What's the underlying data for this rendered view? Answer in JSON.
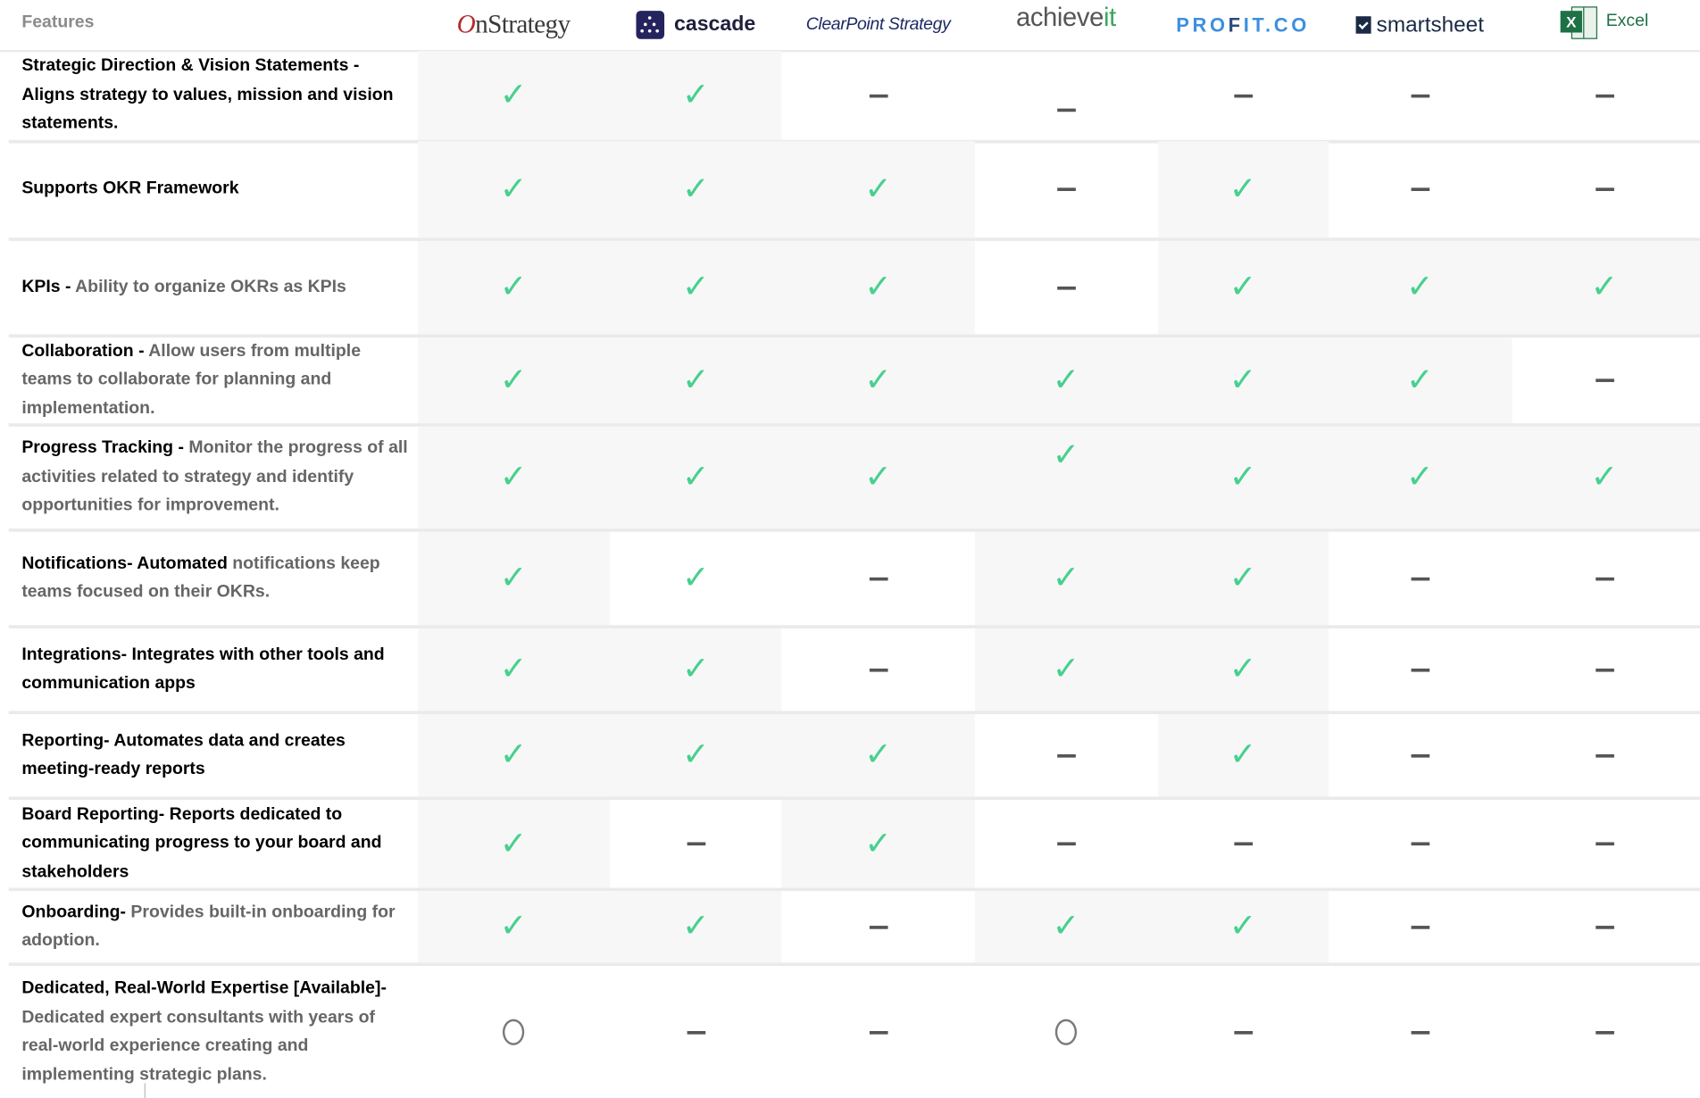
{
  "header": {
    "features_label": "Features",
    "vendors": [
      {
        "id": "onstrategy",
        "name": "OnStrategy",
        "logo_first": "O",
        "logo_rest": "nStrategy"
      },
      {
        "id": "cascade",
        "name": "cascade"
      },
      {
        "id": "clearpoint",
        "name": "ClearPoint Strategy"
      },
      {
        "id": "achieveit",
        "name": "achieveit",
        "logo_main": "achieve",
        "logo_accent": "it"
      },
      {
        "id": "profit",
        "name": "PROFIT.CO",
        "logo_main": "PRO",
        "logo_mid": "F",
        "logo_rest": "IT.CO"
      },
      {
        "id": "smartsheet",
        "name": "smartsheet"
      },
      {
        "id": "excel",
        "name": "Excel",
        "icon_letter": "X"
      }
    ]
  },
  "rows": [
    {
      "title": "Strategic Direction & Vision Statements - Aligns strategy to values, mission and vision statements.",
      "desc": "",
      "cells": [
        "check",
        "check",
        "dash",
        "dash",
        "dash",
        "dash",
        "dash"
      ]
    },
    {
      "title": "Supports OKR Framework",
      "desc": "",
      "cells": [
        "check",
        "check",
        "check",
        "dash",
        "check",
        "dash",
        "dash"
      ]
    },
    {
      "title": "KPIs - ",
      "desc": "Ability to organize OKRs as KPIs",
      "cells": [
        "check",
        "check",
        "check",
        "dash",
        "check",
        "check",
        "check"
      ]
    },
    {
      "title": "Collaboration - ",
      "desc": "Allow users from multiple teams to collaborate for planning and implementation.",
      "cells": [
        "check",
        "check",
        "check",
        "check",
        "check",
        "check",
        "dash"
      ]
    },
    {
      "title": "Progress Tracking - ",
      "desc": "Monitor the progress of all activities related to strategy and identify opportunities for improvement.",
      "cells": [
        "check",
        "check",
        "check",
        "check",
        "check",
        "check",
        "check"
      ]
    },
    {
      "title": "Notifications- Automated ",
      "desc": "notifications keep teams focused on their OKRs.",
      "cells": [
        "check",
        "check",
        "dash",
        "check",
        "check",
        "dash",
        "dash"
      ]
    },
    {
      "title": "Integrations- Integrates with other tools and communication apps",
      "desc": "",
      "cells": [
        "check",
        "check",
        "dash",
        "check",
        "check",
        "dash",
        "dash"
      ]
    },
    {
      "title": "Reporting- Automates data and creates meeting-ready reports",
      "desc": "",
      "cells": [
        "check",
        "check",
        "check",
        "dash",
        "check",
        "dash",
        "dash"
      ]
    },
    {
      "title": "Board Reporting- Reports dedicated to communicating progress to your board and stakeholders",
      "desc": "",
      "cells": [
        "check",
        "dash",
        "check",
        "dash",
        "dash",
        "dash",
        "dash"
      ]
    },
    {
      "title": "Onboarding- ",
      "desc": "Provides built-in onboarding for adoption.",
      "cells": [
        "check",
        "check",
        "dash",
        "check",
        "check",
        "dash",
        "dash"
      ]
    },
    {
      "title": "Dedicated, Real-World Expertise [Available]- ",
      "desc": "Dedicated expert consultants with years of real-world experience creating and implementing strategic plans.",
      "cells": [
        "circle",
        "dash",
        "dash",
        "circle",
        "dash",
        "dash",
        "dash"
      ]
    }
  ],
  "symbols": {
    "check": "✓",
    "dash": "–",
    "circle": "O"
  },
  "colors": {
    "check": "#47d08e",
    "dash": "#555555",
    "row_shade": "#f7f7f7",
    "divider": "#eaeaea"
  }
}
